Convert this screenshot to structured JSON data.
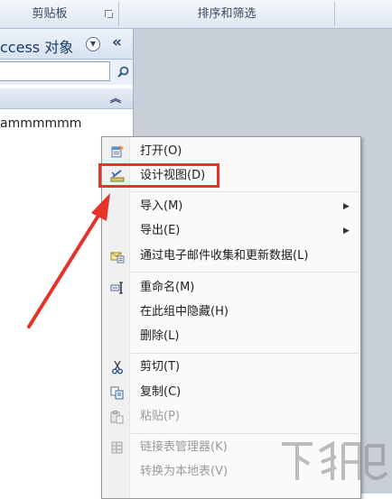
{
  "ribbon": {
    "clipboard_label": "剪贴板",
    "sort_filter_label": "排序和筛选"
  },
  "nav": {
    "title": "ccess 对象",
    "search": {
      "value": "",
      "placeholder": ""
    },
    "table_item": "ammmmmm"
  },
  "context_menu": {
    "items": [
      {
        "label": "打开(O)",
        "icon": "open-icon"
      },
      {
        "label": "设计视图(D)",
        "icon": "design-view-icon"
      },
      {
        "label": "导入(M)",
        "submenu": true
      },
      {
        "label": "导出(E)",
        "submenu": true
      },
      {
        "label": "通过电子邮件收集和更新数据(L)",
        "icon": "email-collect-icon"
      },
      {
        "label": "重命名(M)",
        "icon": "rename-icon"
      },
      {
        "label": "在此组中隐藏(H)"
      },
      {
        "label": "删除(L)"
      },
      {
        "label": "剪切(T)",
        "icon": "cut-icon"
      },
      {
        "label": "复制(C)",
        "icon": "copy-icon"
      },
      {
        "label": "粘贴(P)",
        "icon": "paste-icon",
        "disabled": true
      },
      {
        "label": "链接表管理器(K)",
        "icon": "linked-table-manager-icon",
        "disabled": true
      },
      {
        "label": "转换为本地表(V)",
        "disabled": true
      }
    ]
  },
  "watermark": {
    "text": "下载吧"
  },
  "colors": {
    "highlight": "#e5332a",
    "nav_title": "#16375f"
  }
}
